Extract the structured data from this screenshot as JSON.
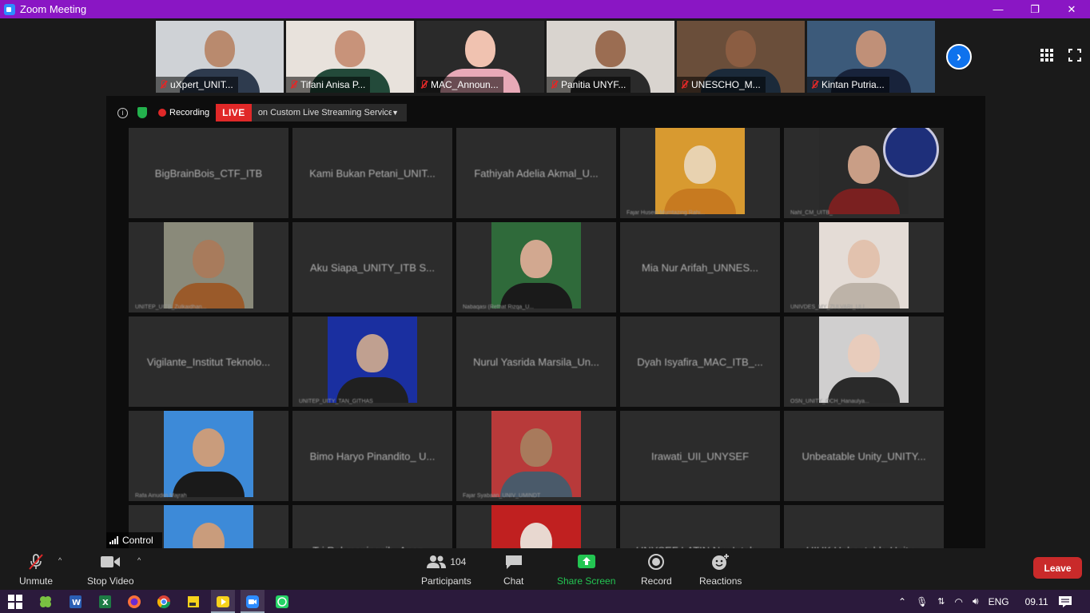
{
  "window": {
    "title": "Zoom Meeting",
    "controls": [
      "—",
      "❐",
      "✕"
    ]
  },
  "strip": {
    "participants": [
      {
        "label": "uXpert_UNIT...",
        "bg": "#cfd2d6",
        "skin": "#b98a6e",
        "shirt": "#2e3b4e"
      },
      {
        "label": "Tifani Anisa P...",
        "bg": "#e8e2dc",
        "skin": "#c8937a",
        "shirt": "#234a3a"
      },
      {
        "label": "MAC_Announ...",
        "bg": "#2a2a2a",
        "skin": "#f0c2b0",
        "shirt": "#e8a9b7"
      },
      {
        "label": "Panitia UNYF...",
        "bg": "#d9d4cf",
        "skin": "#9b6d52",
        "shirt": "#2a2a2a"
      },
      {
        "label": "UNESCHO_M...",
        "bg": "#6a4e3a",
        "skin": "#8b5d42",
        "shirt": "#1b2a3a"
      },
      {
        "label": "Kintan Putria...",
        "bg": "#3c5a7a",
        "skin": "#c09078",
        "shirt": "#18233b"
      }
    ]
  },
  "infobar": {
    "recording": "Recording",
    "live": "LIVE",
    "stream": "on Custom Live Streaming Service"
  },
  "gallery": {
    "rows": [
      [
        {
          "name": "BigBrainBois_CTF_ITB",
          "photo": false
        },
        {
          "name": "Kami Bukan Petani_UNIT...",
          "photo": false
        },
        {
          "name": "Fathiyah Adelia Akmal_U...",
          "photo": false
        },
        {
          "name": "",
          "photo": true,
          "small": "Fajar Husein Mumtazing Rahi...",
          "bg": "#d89a30",
          "skin": "#e8d2b0",
          "shirt": "#c77a20"
        },
        {
          "name": "",
          "photo": true,
          "small": "Nahl_CM_UITB_",
          "bg": "#2a2a2a",
          "skin": "#c99e86",
          "shirt": "#7a2020",
          "logo": true
        }
      ],
      [
        {
          "name": "",
          "photo": true,
          "small": "UNITEP_UITB_Zulkaidhan...",
          "bg": "#8a8a7a",
          "skin": "#a87b5c",
          "shirt": "#9a5a2a"
        },
        {
          "name": "Aku Siapa_UNITY_ITB S...",
          "photo": false
        },
        {
          "name": "",
          "photo": true,
          "small": "Nabaqasi (Refhat Rizqa_U...",
          "bg": "#2f6a3a",
          "skin": "#d2a890",
          "shirt": "#1a1a1a"
        },
        {
          "name": "Mia Nur Arifah_UNNES...",
          "photo": false
        },
        {
          "name": "",
          "photo": true,
          "small": "UNIVDES_MY_ZULVARI_ULI...",
          "bg": "#e4dcd6",
          "skin": "#e2c2ae",
          "shirt": "#bdb3a8"
        }
      ],
      [
        {
          "name": "Vigilante_Institut Teknolo...",
          "photo": false
        },
        {
          "name": "",
          "photo": true,
          "small": "UNITEP_UITY_TAN_GITHAS",
          "bg": "#1a2fa0",
          "skin": "#c0a090",
          "shirt": "#202020"
        },
        {
          "name": "Nurul Yasrida Marsila_Un...",
          "photo": false
        },
        {
          "name": "Dyah Isyafira_MAC_ITB_...",
          "photo": false
        },
        {
          "name": "",
          "photo": true,
          "small": "OSN_UNITY_OCH_Hanaulya...",
          "bg": "#d0cfcf",
          "skin": "#e8ccbc",
          "shirt": "#2a2a2a"
        }
      ],
      [
        {
          "name": "",
          "photo": true,
          "small": "Rafa Ainudiin Majrah",
          "bg": "#3d8ad8",
          "skin": "#c99c7c",
          "shirt": "#1a1a1a"
        },
        {
          "name": "Bimo Haryo Pinandito_ U...",
          "photo": false
        },
        {
          "name": "",
          "photo": true,
          "small": "Fajar Syabaan_UNIV_UMINDT",
          "bg": "#b83a3a",
          "skin": "#a87a5c",
          "shirt": "#4a5a6a"
        },
        {
          "name": "Irawati_UII_UNYSEF",
          "photo": false
        },
        {
          "name": "Unbeatable Unity_UNITY...",
          "photo": false
        }
      ],
      [
        {
          "name": "",
          "photo": true,
          "small": "",
          "bg": "#3d8ad8",
          "skin": "#c99c7c",
          "shirt": "#1a1a1a"
        },
        {
          "name": "Tri Rahmaningsih_Anon...",
          "photo": false
        },
        {
          "name": "",
          "photo": true,
          "small": "",
          "bg": "#c02020",
          "skin": "#e8d8d0",
          "shirt": "#e8e8e8"
        },
        {
          "name": "UNYSEF LATIN Nur Intah...",
          "photo": false
        },
        {
          "name": "UIUK Unbeatable Unity...",
          "photo": false
        }
      ]
    ]
  },
  "control_label": "Control",
  "toolbar": {
    "unmute": "Unmute",
    "stop_video": "Stop Video",
    "participants_count": "104",
    "participants": "Participants",
    "chat": "Chat",
    "share_screen": "Share Screen",
    "record": "Record",
    "reactions": "Reactions",
    "leave": "Leave"
  },
  "taskbar": {
    "language": "ENG",
    "time": "09.11"
  },
  "colors": {
    "title_bar": "#8a16c4",
    "share_green": "#23c552",
    "leave_red": "#c92a2a",
    "live_red": "#e02828"
  }
}
